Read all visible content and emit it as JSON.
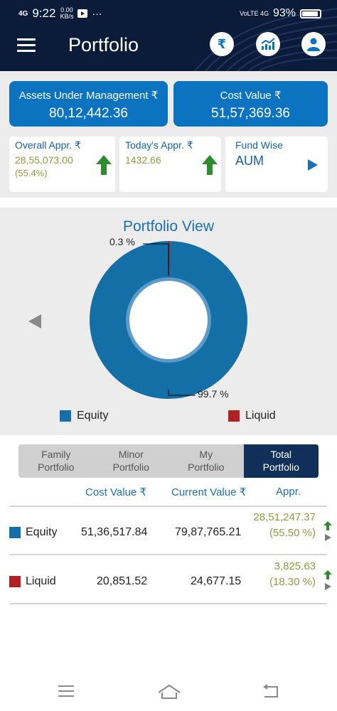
{
  "status_bar": {
    "signal": "4G",
    "time": "9:22",
    "net_speed": "0.00",
    "net_unit": "KB/s",
    "more": "···",
    "carrier": "VoLTE 4G",
    "battery": "93%"
  },
  "header": {
    "title": "Portfolio"
  },
  "summary": {
    "aum_label": "Assets Under Management ₹",
    "aum_value": "80,12,442.36",
    "cost_label": "Cost Value ₹",
    "cost_value": "51,57,369.36",
    "overall_label": "Overall Appr. ₹",
    "overall_value": "28,55,073.00",
    "overall_pct": "(55.4%)",
    "today_label": "Today's Appr. ₹",
    "today_value": "1432.66",
    "fundwise_label": "Fund Wise",
    "fundwise_value": "AUM"
  },
  "portfolio_view": {
    "title": "Portfolio View",
    "label_small": "0.3 %",
    "label_large": "99.7 %",
    "slices": [
      {
        "name": "Equity",
        "percent": 99.7,
        "color": "#136fa6"
      },
      {
        "name": "Liquid",
        "percent": 0.3,
        "color": "#b22222"
      }
    ]
  },
  "tabs": [
    {
      "line1": "Family",
      "line2": "Portfolio"
    },
    {
      "line1": "Minor",
      "line2": "Portfolio"
    },
    {
      "line1": "My",
      "line2": "Portfolio"
    },
    {
      "line1": "Total",
      "line2": "Portfolio"
    }
  ],
  "table": {
    "headers": {
      "cost": "Cost Value ₹",
      "current": "Current Value ₹",
      "appr": "Appr."
    },
    "rows": [
      {
        "name": "Equity",
        "color": "#136fa6",
        "cost": "51,36,517.84",
        "current": "79,87,765.21",
        "appr": "28,51,247.37",
        "appr_pct": "(55.50 %)"
      },
      {
        "name": "Liquid",
        "color": "#b22222",
        "cost": "20,851.52",
        "current": "24,677.15",
        "appr": "3,825.63",
        "appr_pct": "(18.30 %)"
      }
    ]
  },
  "colors": {
    "header_bg": "#0b1b3a",
    "accent_blue": "#0b73c0",
    "green_up": "#2e8b2e",
    "appr_text": "#8aa040"
  },
  "icons": [
    "menu-icon",
    "rupee-icon",
    "chart-icon",
    "user-icon",
    "arrow-up-icon",
    "play-right-icon",
    "chevron-left-icon",
    "nav-menu-icon",
    "nav-home-icon",
    "nav-back-icon"
  ]
}
